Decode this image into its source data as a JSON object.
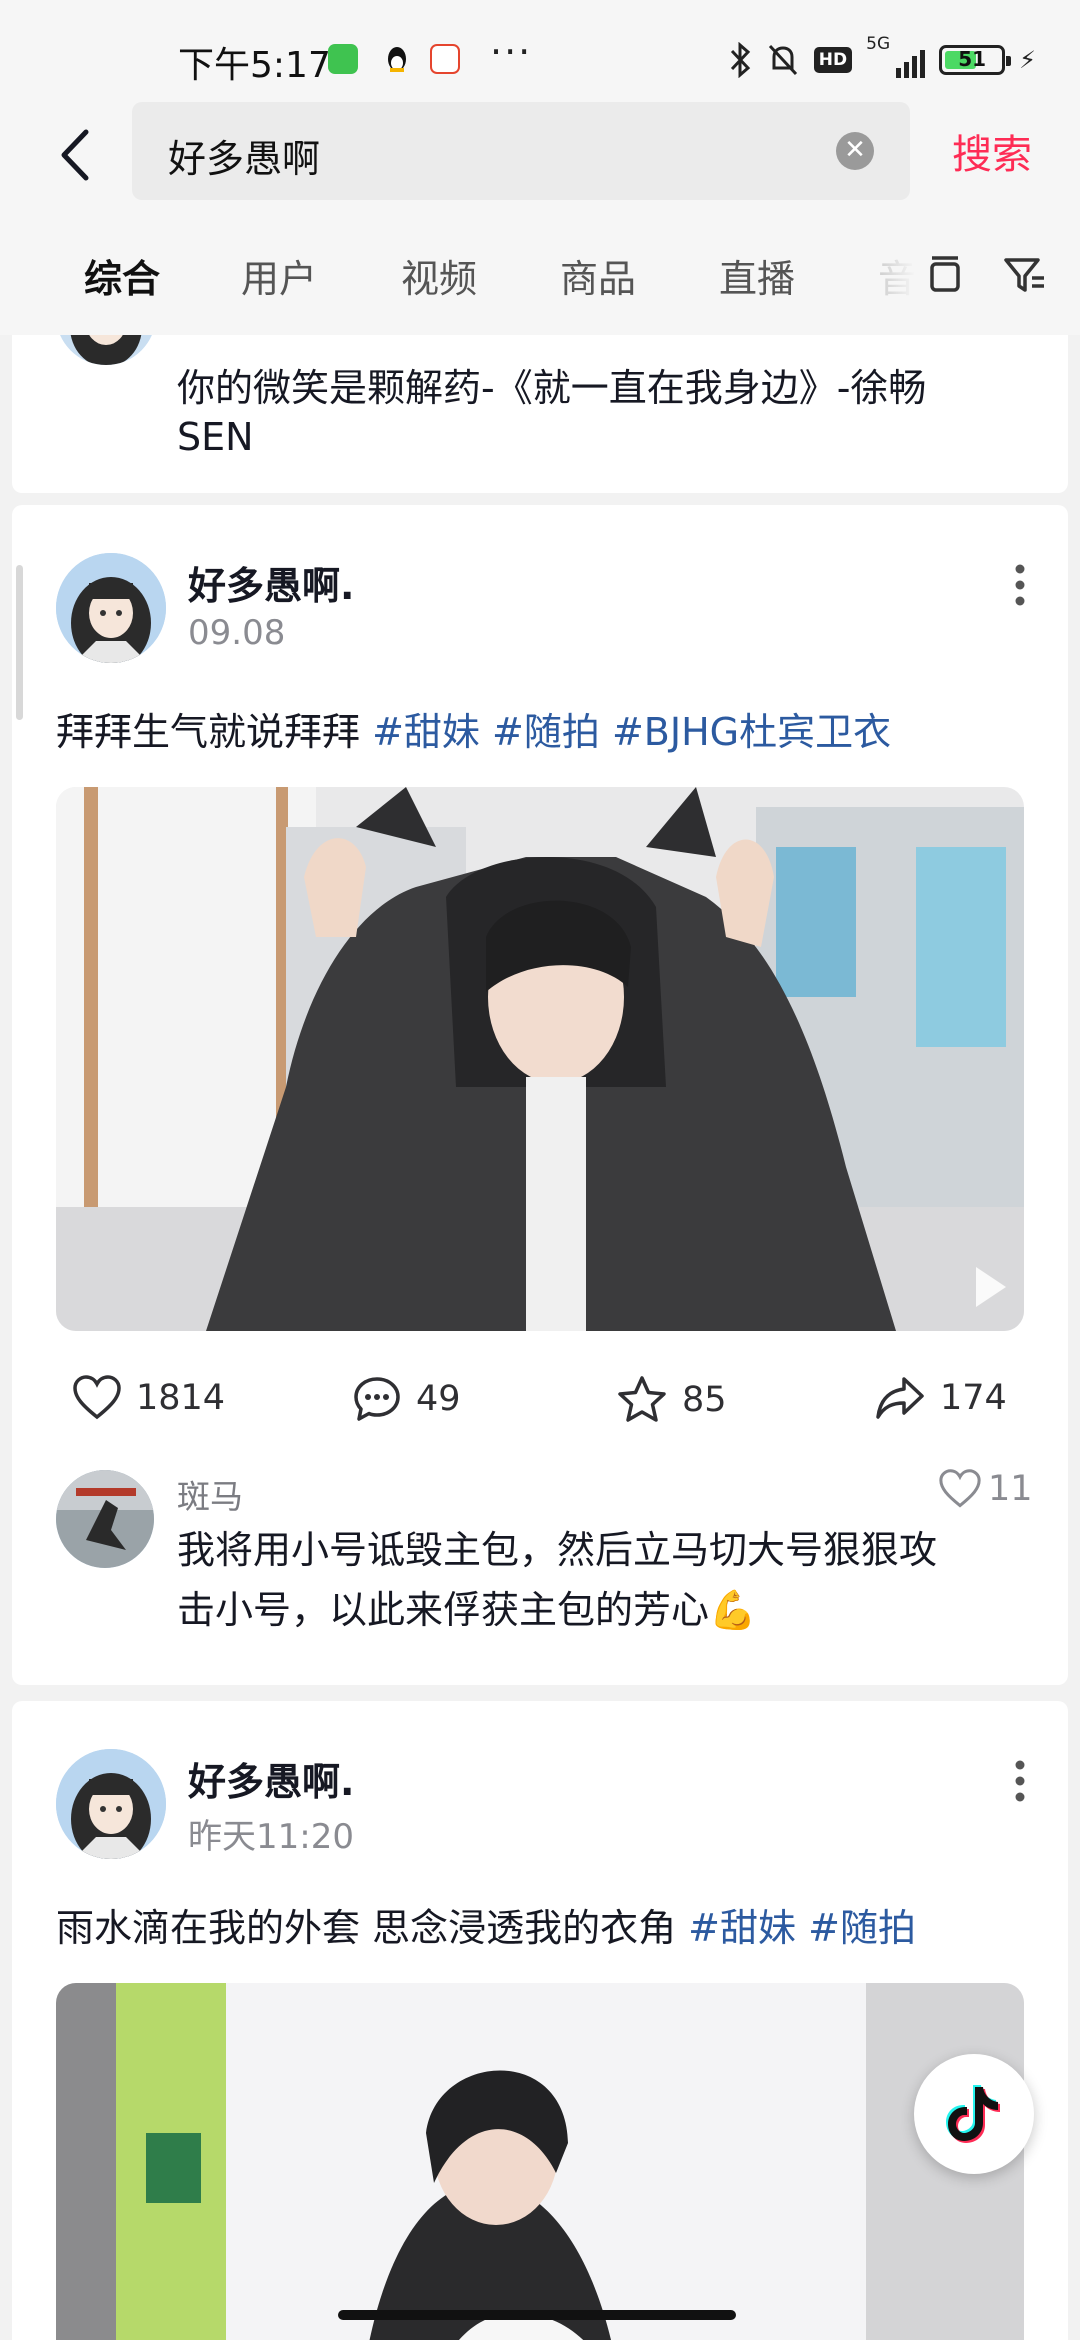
{
  "status_bar": {
    "time": "下午5:17",
    "more": "···",
    "network": "5G",
    "hd": "HD",
    "battery": "51",
    "battery_level": 0.51
  },
  "search": {
    "query": "好多愚啊",
    "clear_icon": "clear-icon",
    "button": "搜索"
  },
  "tabs": [
    "综合",
    "用户",
    "视频",
    "商品",
    "直播",
    "音"
  ],
  "feed": {
    "prev_post": {
      "title_line1": "你的微笑是颗解药-《就一直在我身边》-徐畅",
      "title_line2": "SEN"
    },
    "post1": {
      "author": "好多愚啊.",
      "time": "09.08",
      "text": "拜拜生气就说拜拜 ",
      "tags": [
        "#甜妹",
        "#随拍",
        "#BJHG杜宾卫衣"
      ],
      "likes": "1814",
      "comments": "49",
      "favorites": "85",
      "shares": "174",
      "top_comment": {
        "user": "斑马",
        "line1": "我将用小号诋毁主包，然后立马切大号狠狠攻",
        "line2": "击小号，以此来俘获主包的芳心💪",
        "likes": "11"
      }
    },
    "post2": {
      "author": "好多愚啊.",
      "time": "昨天11:20",
      "text": "雨水滴在我的外套 思念浸透我的衣角 ",
      "tags": [
        "#甜妹",
        "#随拍"
      ]
    }
  },
  "icons": {
    "back": "back-arrow-icon",
    "layout": "layout-toggle-icon",
    "filter": "filter-icon",
    "like": "heart-icon",
    "comment": "comment-icon",
    "favorite": "star-icon",
    "share": "share-icon",
    "app": "douyin-logo-icon"
  }
}
